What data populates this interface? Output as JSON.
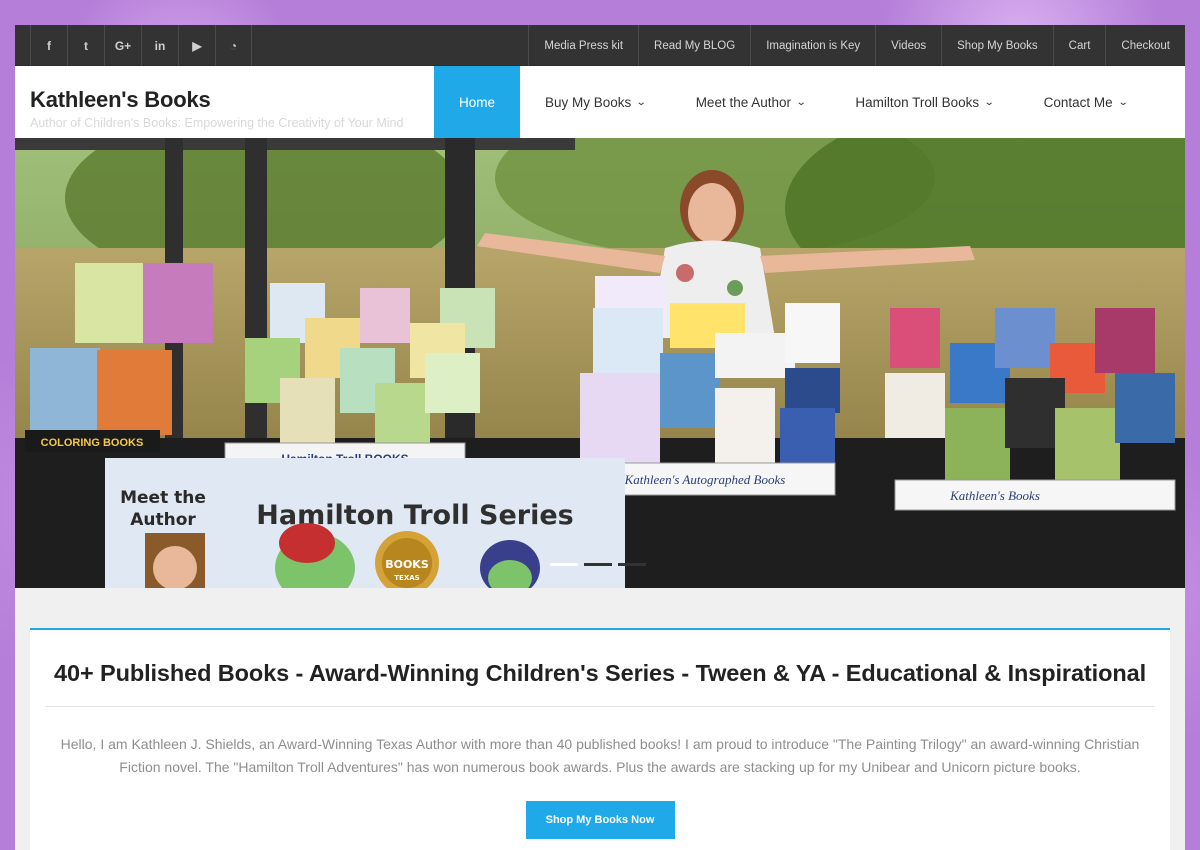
{
  "social": [
    {
      "icon": "facebook-icon",
      "glyph": "f"
    },
    {
      "icon": "twitter-icon",
      "glyph": "t"
    },
    {
      "icon": "google-plus-icon",
      "glyph": "G+"
    },
    {
      "icon": "linkedin-icon",
      "glyph": "in"
    },
    {
      "icon": "youtube-icon",
      "glyph": "▶"
    },
    {
      "icon": "rss-icon",
      "glyph": "◔"
    }
  ],
  "toplinks": [
    "Media Press kit",
    "Read My BLOG",
    "Imagination is Key",
    "Videos",
    "Shop My Books",
    "Cart",
    "Checkout"
  ],
  "brand": {
    "name": "Kathleen's Books",
    "tagline": "Author of Children's Books: Empowering the Creativity of Your Mind"
  },
  "nav": [
    {
      "label": "Home",
      "active": true,
      "dropdown": false
    },
    {
      "label": "Buy My Books",
      "active": false,
      "dropdown": true
    },
    {
      "label": "Meet the Author",
      "active": false,
      "dropdown": true
    },
    {
      "label": "Hamilton Troll Books",
      "active": false,
      "dropdown": true
    },
    {
      "label": "Contact Me",
      "active": false,
      "dropdown": true
    }
  ],
  "hero": {
    "sign_meet": "Meet the",
    "sign_author": "Author",
    "banner": "Hamilton Troll Series",
    "seal_books": "BOOKS",
    "seal_texas": "TEXAS",
    "shelf_troll": "Hamilton Troll BOOKS",
    "shelf_autograph": "Kathleen's Autographed Books",
    "shelf_kathleen": "Kathleen's Books",
    "coloring": "COLORING BOOKS",
    "slides_total": 3,
    "slide_active": 1
  },
  "main": {
    "heading": "40+ Published Books - Award-Winning Children's Series - Tween & YA - Educational & Inspirational",
    "intro": "Hello, I am Kathleen J. Shields, an Award-Winning Texas Author with more than 40 published books! I am proud to introduce \"The Painting Trilogy\" an award-winning Christian Fiction novel. The \"Hamilton Troll Adventures\" has won numerous book awards. Plus the awards are stacking up for my Unibear and Unicorn picture books.",
    "cta": "Shop My Books Now"
  },
  "colors": {
    "accent": "#1fa9e8",
    "topbar": "#333333"
  }
}
